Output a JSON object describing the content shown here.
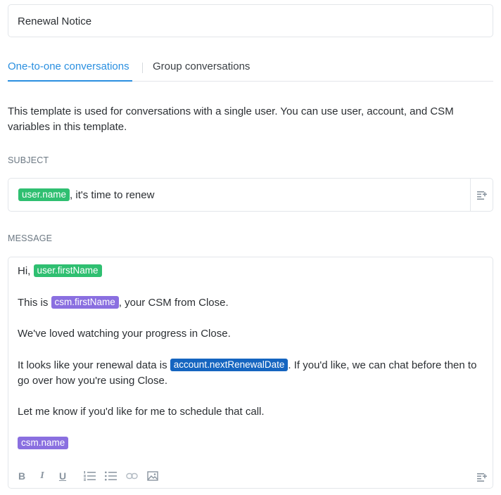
{
  "template_name": "Renewal Notice",
  "tabs": [
    {
      "label": "One-to-one conversations",
      "active": true
    },
    {
      "label": "Group conversations",
      "active": false
    }
  ],
  "description": "This template is used for conversations with a single user. You can use user, account, and CSM variables in this template.",
  "subject": {
    "label": "SUBJECT",
    "variable": "user.name",
    "text": ", it's time to renew"
  },
  "message": {
    "label": "MESSAGE",
    "greeting": "Hi, ",
    "greeting_var": "user.firstName",
    "line2_pre": "This is ",
    "line2_var": "csm.firstName",
    "line2_post": ", your CSM from Close.",
    "line3": "We've loved watching your progress in Close.",
    "line4_pre": "It looks like your renewal data is ",
    "line4_var": "account.nextRenewalDate",
    "line4_post": ". If you'd like, we can chat before then to go over how you're using Close.",
    "line5": "Let me know if you'd like for me to schedule that call.",
    "signature_var": "csm.name"
  },
  "toolbar": {
    "bold": "B",
    "italic": "I",
    "underline": "U",
    "icons": [
      "ordered-list-icon",
      "bullet-list-icon",
      "link-icon",
      "image-icon",
      "insert-variable-icon"
    ]
  },
  "colors": {
    "accent": "#2a8fe0",
    "chip_user": "#2fbf71",
    "chip_csm": "#8a6fe0",
    "chip_account": "#1565c0"
  }
}
